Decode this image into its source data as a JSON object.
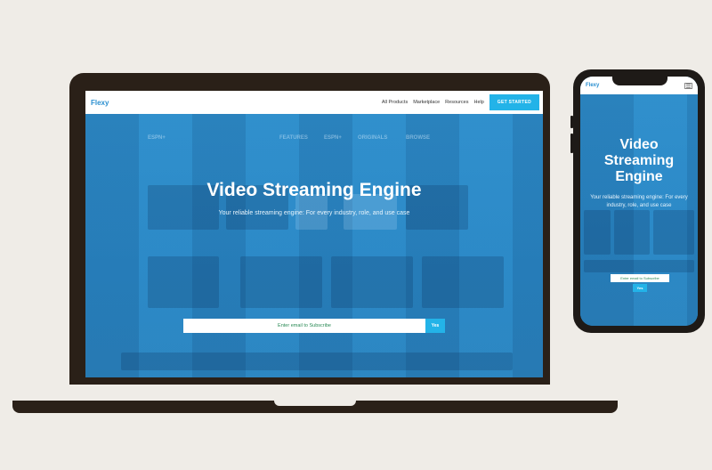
{
  "brand": {
    "logo": "Flexy",
    "accent": "#23b3e8",
    "primary": "#2a8fd0"
  },
  "nav": {
    "links": [
      "All Products",
      "Marketplace",
      "Resources",
      "Help"
    ],
    "cta": "GET STARTED"
  },
  "hero": {
    "title": "Video Streaming Engine",
    "subtitle": "Your reliable streaming engine: For every industry, role, and use case"
  },
  "subscribe": {
    "placeholder": "Enter email to Subscribe",
    "button": "Yes"
  },
  "background_tv": {
    "menu": [
      "ESPN+",
      "FEATURES",
      "ESPN+",
      "ORIGINALS",
      "BROWSE"
    ]
  },
  "phone": {
    "logo": "Flexy",
    "title": "Video Streaming Engine",
    "subtitle": "Your reliable streaming engine: For every industry, role, and use case",
    "subscribe_placeholder": "Enter email to Subscribe",
    "subscribe_button": "Yes",
    "menu_icon": "hamburger-icon"
  }
}
